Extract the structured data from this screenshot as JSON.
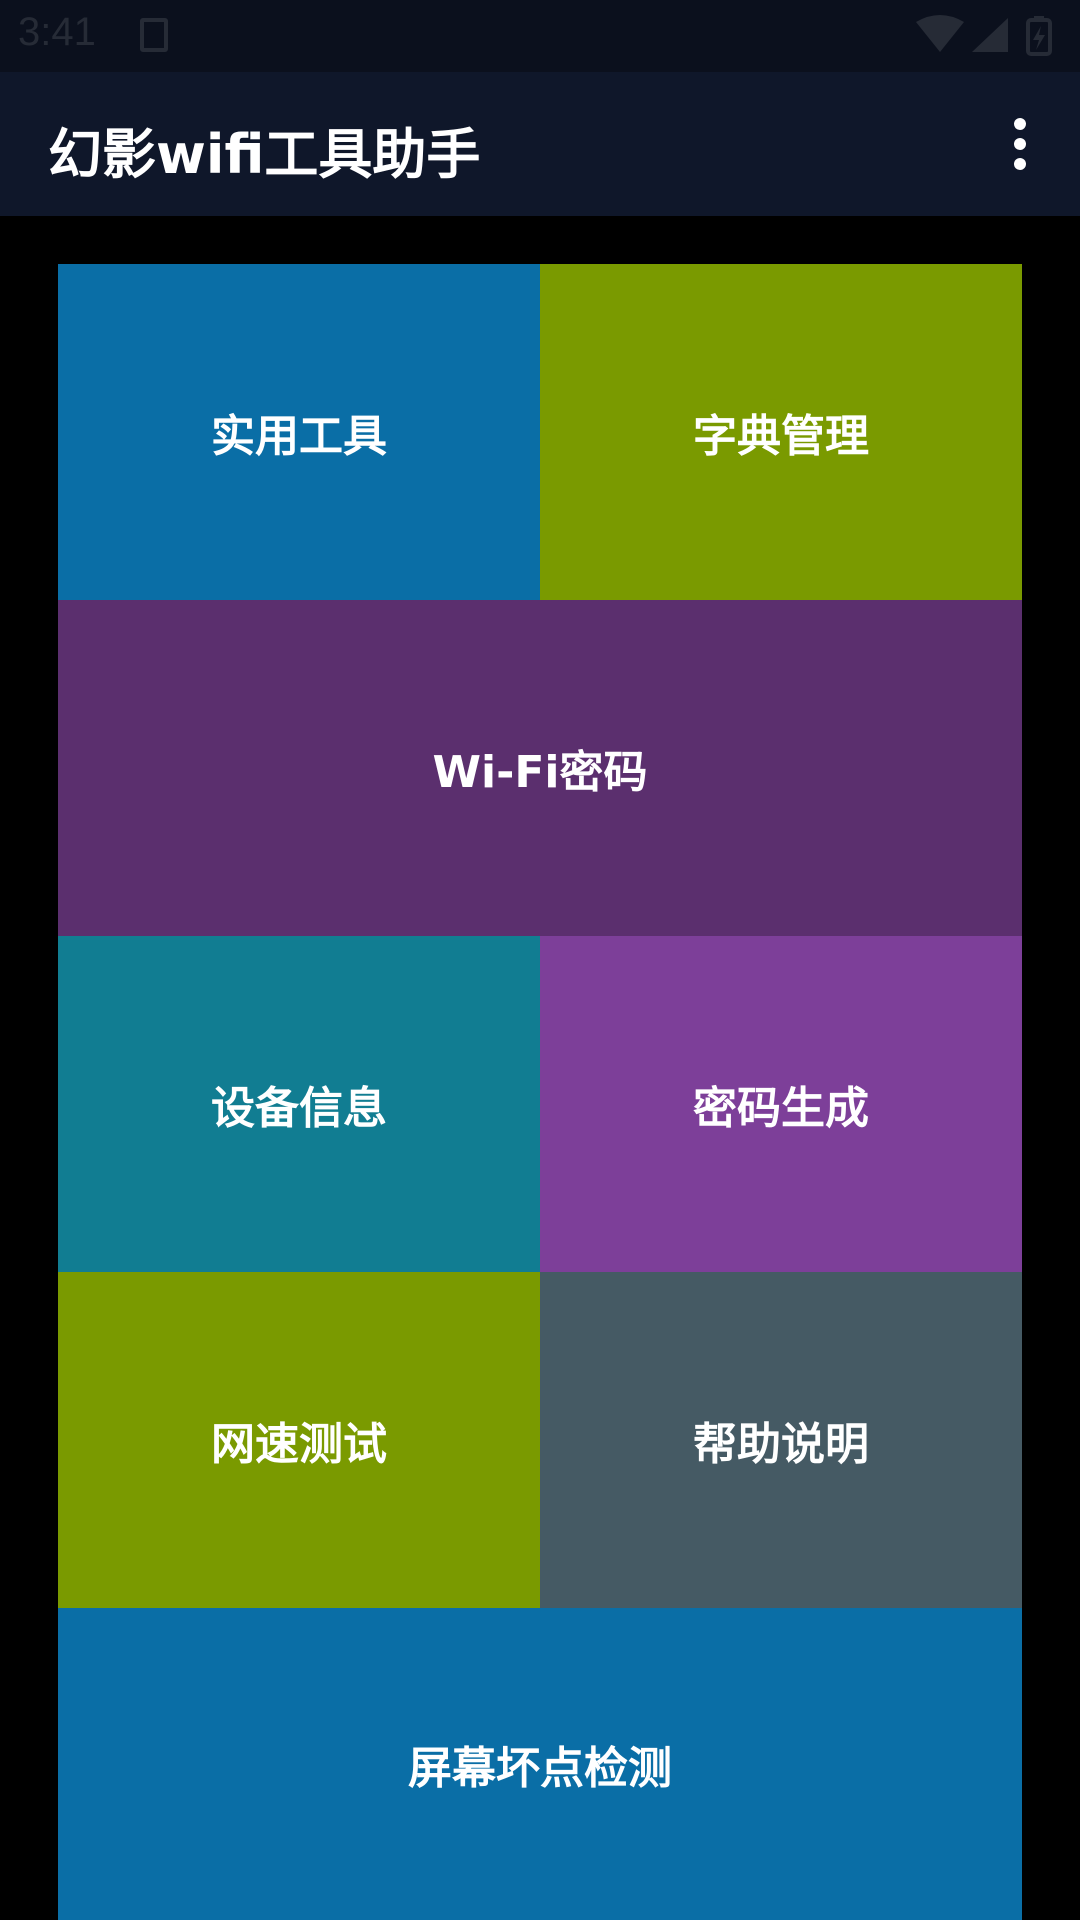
{
  "status_bar": {
    "time": "3:41",
    "icons": [
      "notification-icon",
      "wifi-icon",
      "signal-icon",
      "battery-icon"
    ]
  },
  "app_bar": {
    "title": "幻影wifi工具助手",
    "menu_icon": "more-vert-icon"
  },
  "tiles": [
    {
      "label": "实用工具",
      "color": "#0a6ea6"
    },
    {
      "label": "字典管理",
      "color": "#7a9a00"
    },
    {
      "label": "Wi-Fi密码",
      "color": "#5b2f6e"
    },
    {
      "label": "设备信息",
      "color": "#117d92"
    },
    {
      "label": "密码生成",
      "color": "#7d3f99"
    },
    {
      "label": "网速测试",
      "color": "#7a9a00"
    },
    {
      "label": "帮助说明",
      "color": "#455a64"
    },
    {
      "label": "屏幕坏点检测",
      "color": "#0a6ea6"
    }
  ]
}
